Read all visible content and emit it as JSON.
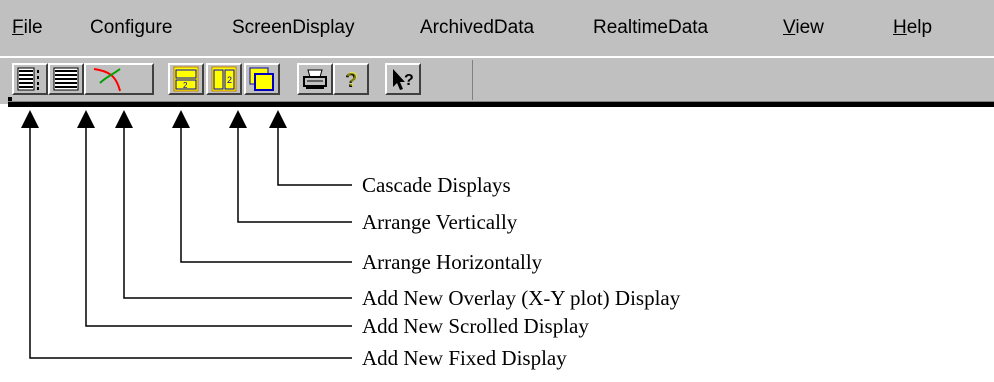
{
  "menu": {
    "file": {
      "prefix": "",
      "underlined": "F",
      "rest": "ile"
    },
    "configure": "Configure",
    "screen_display": "ScreenDisplay",
    "archived_data": "ArchivedData",
    "realtime_data": "RealtimeData",
    "view": {
      "prefix": "",
      "underlined": "V",
      "rest": "iew"
    },
    "help": {
      "prefix": "",
      "underlined": "H",
      "rest": "elp"
    }
  },
  "toolbar": {
    "buttons": [
      {
        "name": "add-fixed-display",
        "icon": "fixed-display-icon"
      },
      {
        "name": "add-scrolled-display",
        "icon": "scrolled-display-icon"
      },
      {
        "name": "add-overlay-display",
        "icon": "xy-plot-icon"
      },
      {
        "name": "arrange-horizontally",
        "icon": "tile-horizontal-icon"
      },
      {
        "name": "arrange-vertically",
        "icon": "tile-vertical-icon"
      },
      {
        "name": "cascade-displays",
        "icon": "cascade-icon"
      },
      {
        "name": "print",
        "icon": "printer-icon"
      },
      {
        "name": "help",
        "icon": "question-mark-icon"
      },
      {
        "name": "context-help",
        "icon": "pointer-question-icon"
      }
    ]
  },
  "callouts": {
    "cascade": "Cascade Displays",
    "vertical": "Arrange Vertically",
    "horizontal": "Arrange Horizontally",
    "overlay": "Add New Overlay (X-Y plot) Display",
    "scrolled": "Add New Scrolled Display",
    "fixed": "Add New Fixed Display"
  },
  "colors": {
    "chrome": "#c0c0c0",
    "tile_yellow": "#ffff00",
    "tile_blue": "#0000c0",
    "accent_red": "#ff0000",
    "accent_green": "#00a000"
  }
}
